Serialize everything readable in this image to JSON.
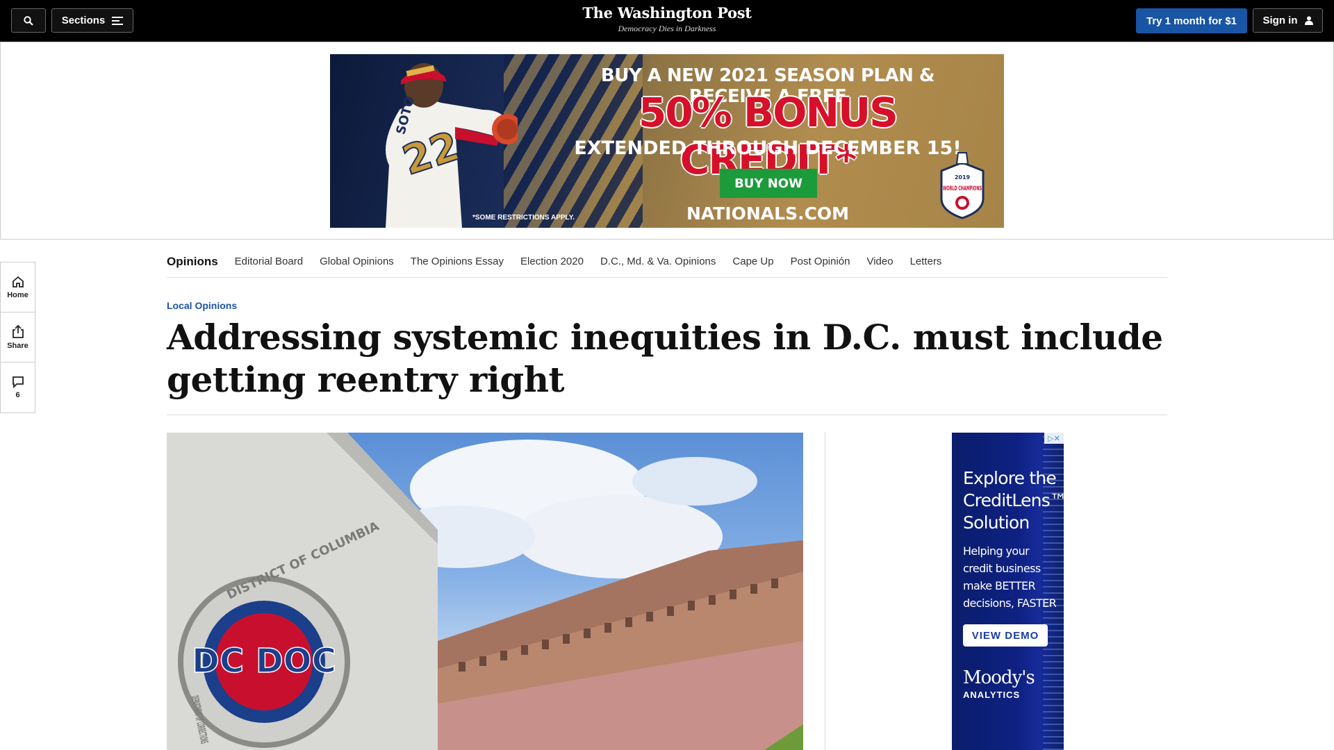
{
  "topbar": {
    "sections_label": "Sections",
    "logo_text": "The Washington Post",
    "tagline": "Democracy Dies in Darkness",
    "trial_label": "Try 1 month for $1",
    "signin_label": "Sign in"
  },
  "banner_ad": {
    "line1": "BUY A NEW 2021 SEASON PLAN & RECEIVE A FREE",
    "line2": "50% BONUS CREDIT*",
    "line3": "EXTENDED THROUGH DECEMBER 15!",
    "button": "BUY NOW",
    "site": "NATIONALS.COM",
    "restrictions": "*SOME RESTRICTIONS APPLY.",
    "jersey_name": "SOTO",
    "jersey_number": "22",
    "badge_year": "2019",
    "badge_text": "WORLD CHAMPIONS"
  },
  "rail": {
    "home": "Home",
    "share": "Share",
    "comments": "6"
  },
  "subnav": {
    "home": "Opinions",
    "items": [
      "Editorial Board",
      "Global Opinions",
      "The Opinions Essay",
      "Election 2020",
      "D.C., Md. & Va. Opinions",
      "Cape Up",
      "Post Opinión",
      "Video",
      "Letters"
    ]
  },
  "article": {
    "kicker": "Local Opinions",
    "headline": "Addressing systemic inequities in D.C. must include getting reentry right",
    "photo_sign_text": "DISTRICT OF COLUMBIA",
    "photo_logo": "DC DOC",
    "photo_sign_text2": "DEPARTMENT OF CORRECTIONS"
  },
  "side_ad": {
    "heading": "Explore the CreditLens™ Solution",
    "body": "Helping your credit business make BETTER decisions, FASTER",
    "button": "VIEW DEMO",
    "brand": "Moody's",
    "brand_sub": "ANALYTICS"
  },
  "icons": [
    "search-icon",
    "menu-icon",
    "user-icon",
    "home-icon",
    "share-icon",
    "comment-icon",
    "adchoices-icon"
  ]
}
